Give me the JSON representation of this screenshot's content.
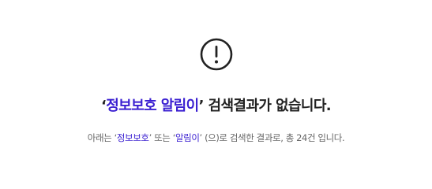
{
  "icon": "exclamation-circle-icon",
  "colors": {
    "accent": "#3a1fd1",
    "heading": "#222222",
    "body": "#666666",
    "icon": "#222222"
  },
  "headline": {
    "open_quote": "‘",
    "query": "정보보호 알림이",
    "close_quote": "’",
    "message": " 검색결과가 없습니다."
  },
  "subline": {
    "prefix": "아래는 ",
    "term1_open": "‘",
    "term1": "정보보호",
    "term1_close": "’",
    "connector": " 또는 ",
    "term2_open": "‘",
    "term2": "알림이",
    "term2_close": "’",
    "suffix": " (으)로 검색한 결과로, 총 24건 입니다."
  }
}
